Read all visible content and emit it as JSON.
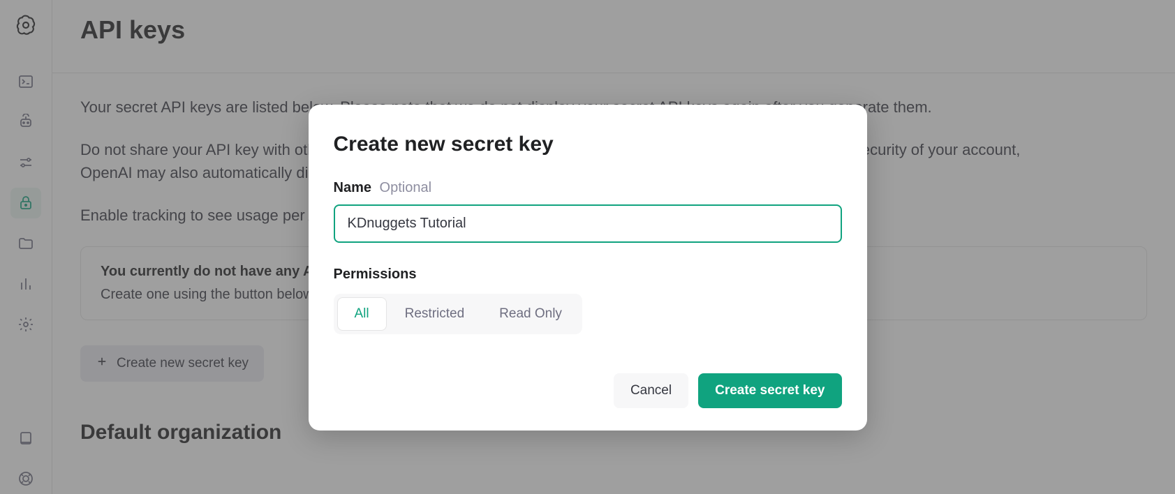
{
  "page": {
    "title": "API keys",
    "intro1": "Your secret API keys are listed below. Please note that we do not display your secret API keys again after you generate them.",
    "intro2": "Do not share your API key with others, or expose it in the browser or other client-side code. In order to protect the security of your account, OpenAI may also automatically disable any API key that we've found has leaked publicly.",
    "intro3": "Enable tracking to see usage per API key on the Usage page.",
    "info_title": "You currently do not have any API keys",
    "info_text": "Create one using the button below to get started",
    "create_button": "Create new secret key",
    "section_default_org": "Default organization"
  },
  "modal": {
    "title": "Create new secret key",
    "name_label": "Name",
    "name_optional": "Optional",
    "name_value": "KDnuggets Tutorial",
    "permissions_label": "Permissions",
    "perm_all": "All",
    "perm_restricted": "Restricted",
    "perm_readonly": "Read Only",
    "cancel": "Cancel",
    "submit": "Create secret key"
  }
}
